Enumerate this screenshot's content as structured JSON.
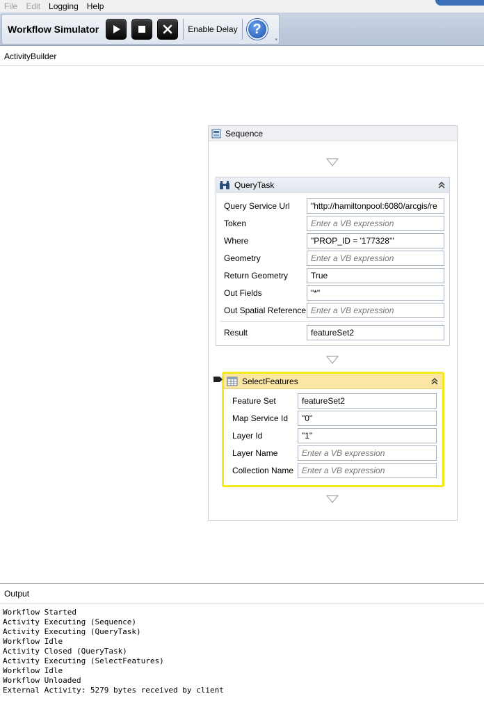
{
  "menu": {
    "items": [
      {
        "label": "File",
        "disabled": true
      },
      {
        "label": "Edit",
        "disabled": true
      },
      {
        "label": "Logging",
        "disabled": false
      },
      {
        "label": "Help",
        "disabled": false
      }
    ]
  },
  "toolbar": {
    "title": "Workflow Simulator",
    "enable_delay": "Enable Delay",
    "help_glyph": "?"
  },
  "breadcrumb": "ActivityBuilder",
  "sequence": {
    "label": "Sequence"
  },
  "query_task": {
    "label": "QueryTask",
    "rows": [
      {
        "label": "Query Service Url",
        "value": "\"http://hamiltonpool:6080/arcgis/re",
        "placeholder": false
      },
      {
        "label": "Token",
        "value": "Enter a VB expression",
        "placeholder": true
      },
      {
        "label": "Where",
        "value": "\"PROP_ID = '177328'\"",
        "placeholder": false
      },
      {
        "label": "Geometry",
        "value": "Enter a VB expression",
        "placeholder": true
      },
      {
        "label": "Return Geometry",
        "value": "True",
        "placeholder": false
      },
      {
        "label": "Out Fields",
        "value": "\"*\"",
        "placeholder": false
      },
      {
        "label": "Out Spatial Reference",
        "value": "Enter a VB expression",
        "placeholder": true
      }
    ],
    "result": {
      "label": "Result",
      "value": "featureSet2"
    }
  },
  "select_features": {
    "label": "SelectFeatures",
    "rows": [
      {
        "label": "Feature Set",
        "value": "featureSet2",
        "placeholder": false
      },
      {
        "label": "Map Service Id",
        "value": "\"0\"",
        "placeholder": false
      },
      {
        "label": "Layer Id",
        "value": "\"1\"",
        "placeholder": false
      },
      {
        "label": "Layer Name",
        "value": "Enter a VB expression",
        "placeholder": true
      },
      {
        "label": "Collection Name",
        "value": "Enter a VB expression",
        "placeholder": true
      }
    ]
  },
  "output": {
    "title": "Output",
    "lines": [
      "Workflow Started",
      "Activity Executing (Sequence)",
      "Activity Executing (QueryTask)",
      "Workflow Idle",
      "Activity Closed (QueryTask)",
      "Activity Executing (SelectFeatures)",
      "Workflow Idle",
      "Workflow Unloaded",
      "External Activity: 5279 bytes received by client"
    ]
  },
  "colors": {
    "selection": "#f2ea1c",
    "selected_header": "#fbe6a6",
    "help": "#1c4fa8"
  },
  "icons": {
    "run": "play-icon",
    "stop": "stop-icon",
    "close": "close-icon",
    "help": "help-icon",
    "sequence": "sequence-icon",
    "query": "binoculars-icon",
    "select": "table-icon",
    "collapse": "double-chevron-up-icon",
    "drop": "triangle-down-icon"
  }
}
